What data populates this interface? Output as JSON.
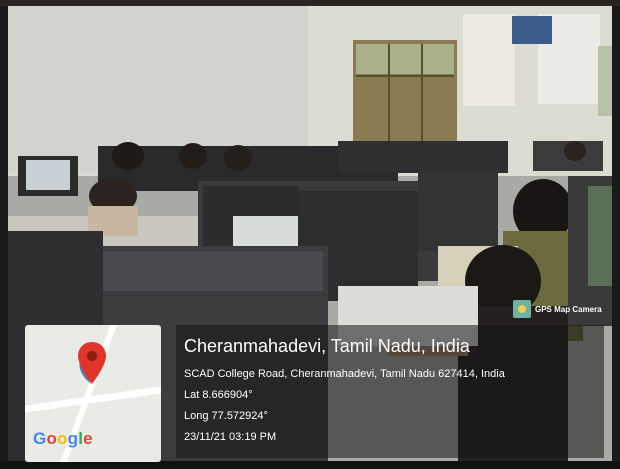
{
  "overlay": {
    "badge_label": "GPS Map Camera",
    "location_title": "Cheranmahadevi, Tamil Nadu, India",
    "address": "SCAD College Road, Cheranmahadevi, Tamil Nadu 627414, India",
    "latitude": "Lat 8.666904°",
    "longitude": "Long 77.572924°",
    "datetime": "23/11/21 03:19 PM",
    "map_brand": "Google"
  },
  "colors": {
    "pin": "#e0352b",
    "google_blue": "#4285f4",
    "google_red": "#ea4335",
    "google_yellow": "#fbbc05",
    "google_green": "#34a853"
  },
  "icons": [
    "map-pin-icon",
    "gps-camera-icon"
  ]
}
